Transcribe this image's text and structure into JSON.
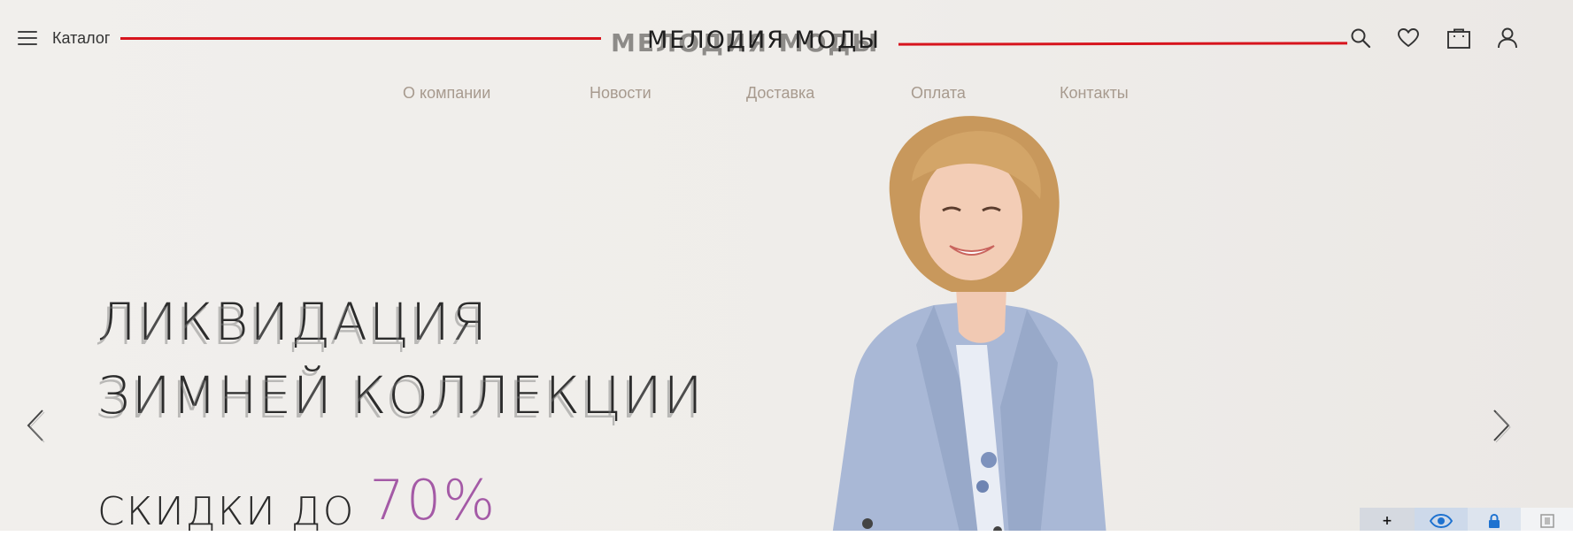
{
  "header": {
    "catalog_label": "Каталог",
    "logo_text_main": "МЕЛОДИЯ МОДЫ",
    "logo_text_ghost": "МЕЛОДИЯ МОДЫ"
  },
  "nav": {
    "items": [
      {
        "label": "О компании"
      },
      {
        "label": "Новости"
      },
      {
        "label": "Доставка"
      },
      {
        "label": "Оплата"
      },
      {
        "label": "Контакты"
      }
    ]
  },
  "hero": {
    "line1": "ЛИКВИДАЦИЯ",
    "line2": "ЗИМНЕЙ КОЛЛЕКЦИИ",
    "line3_prefix": "СКИДКИ ДО ",
    "line3_percent": "70%"
  },
  "icons": {
    "burger": "menu-icon",
    "search": "search-icon",
    "favorites": "heart-icon",
    "cart": "bag-icon",
    "account": "user-icon",
    "prev": "chevron-left-icon",
    "next": "chevron-right-icon"
  },
  "widgets": {
    "plus_label": "+"
  },
  "colors": {
    "accent_red": "#d7141d",
    "discount_purple": "#a45aa6",
    "nav_text": "#a79a8e"
  }
}
